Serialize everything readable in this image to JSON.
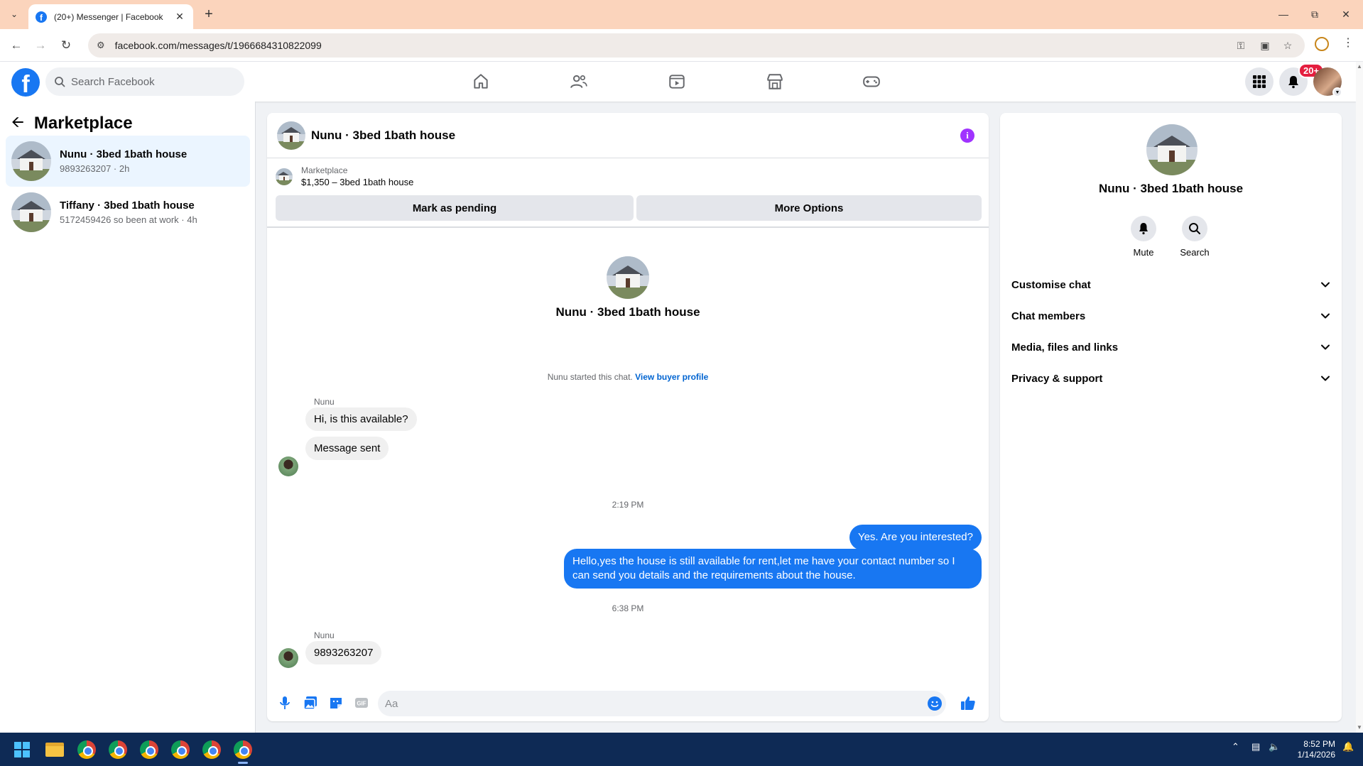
{
  "browser": {
    "tab_title": "(20+) Messenger | Facebook",
    "url": "facebook.com/messages/t/1966684310822099",
    "favicon": "f"
  },
  "fb": {
    "logo": "f",
    "search_placeholder": "Search Facebook",
    "notifications_badge": "20+",
    "nav_icons": [
      "home-icon",
      "friends-icon",
      "video-icon",
      "marketplace-icon",
      "gaming-icon"
    ]
  },
  "left": {
    "title": "Marketplace",
    "chats": [
      {
        "name": "Nunu · 3bed 1bath house",
        "preview": "9893263207 · 2h"
      },
      {
        "name": "Tiffany · 3bed 1bath house",
        "preview": "5172459426 so been at work · 4h"
      }
    ]
  },
  "conversation": {
    "title": "Nunu · 3bed 1bath house",
    "marketplace_label": "Marketplace",
    "listing": "$1,350 – 3bed 1bath house",
    "mark_pending": "Mark as pending",
    "more_options": "More Options",
    "intro_name": "Nunu · 3bed 1bath house",
    "started_text": "Nunu started this chat.",
    "view_buyer_profile": "View buyer profile",
    "messages": {
      "sender1": "Nunu",
      "in1": "Hi, is this available?",
      "in2": "Message sent",
      "time1": "2:19 PM",
      "out1": "Yes. Are you interested?",
      "out2": "Hello,yes the house is still available for rent,let me have your contact number   so I can send you details and the requirements about the house.",
      "time2": "6:38 PM",
      "sender2": "Nunu",
      "in3": "9893263207"
    },
    "composer_placeholder": "Aa"
  },
  "details": {
    "name": "Nunu · 3bed 1bath house",
    "mute": "Mute",
    "search": "Search",
    "sections": [
      "Customise chat",
      "Chat members",
      "Media, files and links",
      "Privacy & support"
    ]
  },
  "taskbar": {
    "time": "8:52 PM",
    "date": "1/14/2026"
  },
  "colors": {
    "fb_blue": "#1877f2",
    "outgoing_bubble": "#1877f2",
    "incoming_bubble": "#f0f0f0",
    "tabstrip": "#fbd4bc",
    "taskbar": "#0e2a55",
    "info_icon": "#a033ff",
    "badge": "#e41e3f"
  }
}
